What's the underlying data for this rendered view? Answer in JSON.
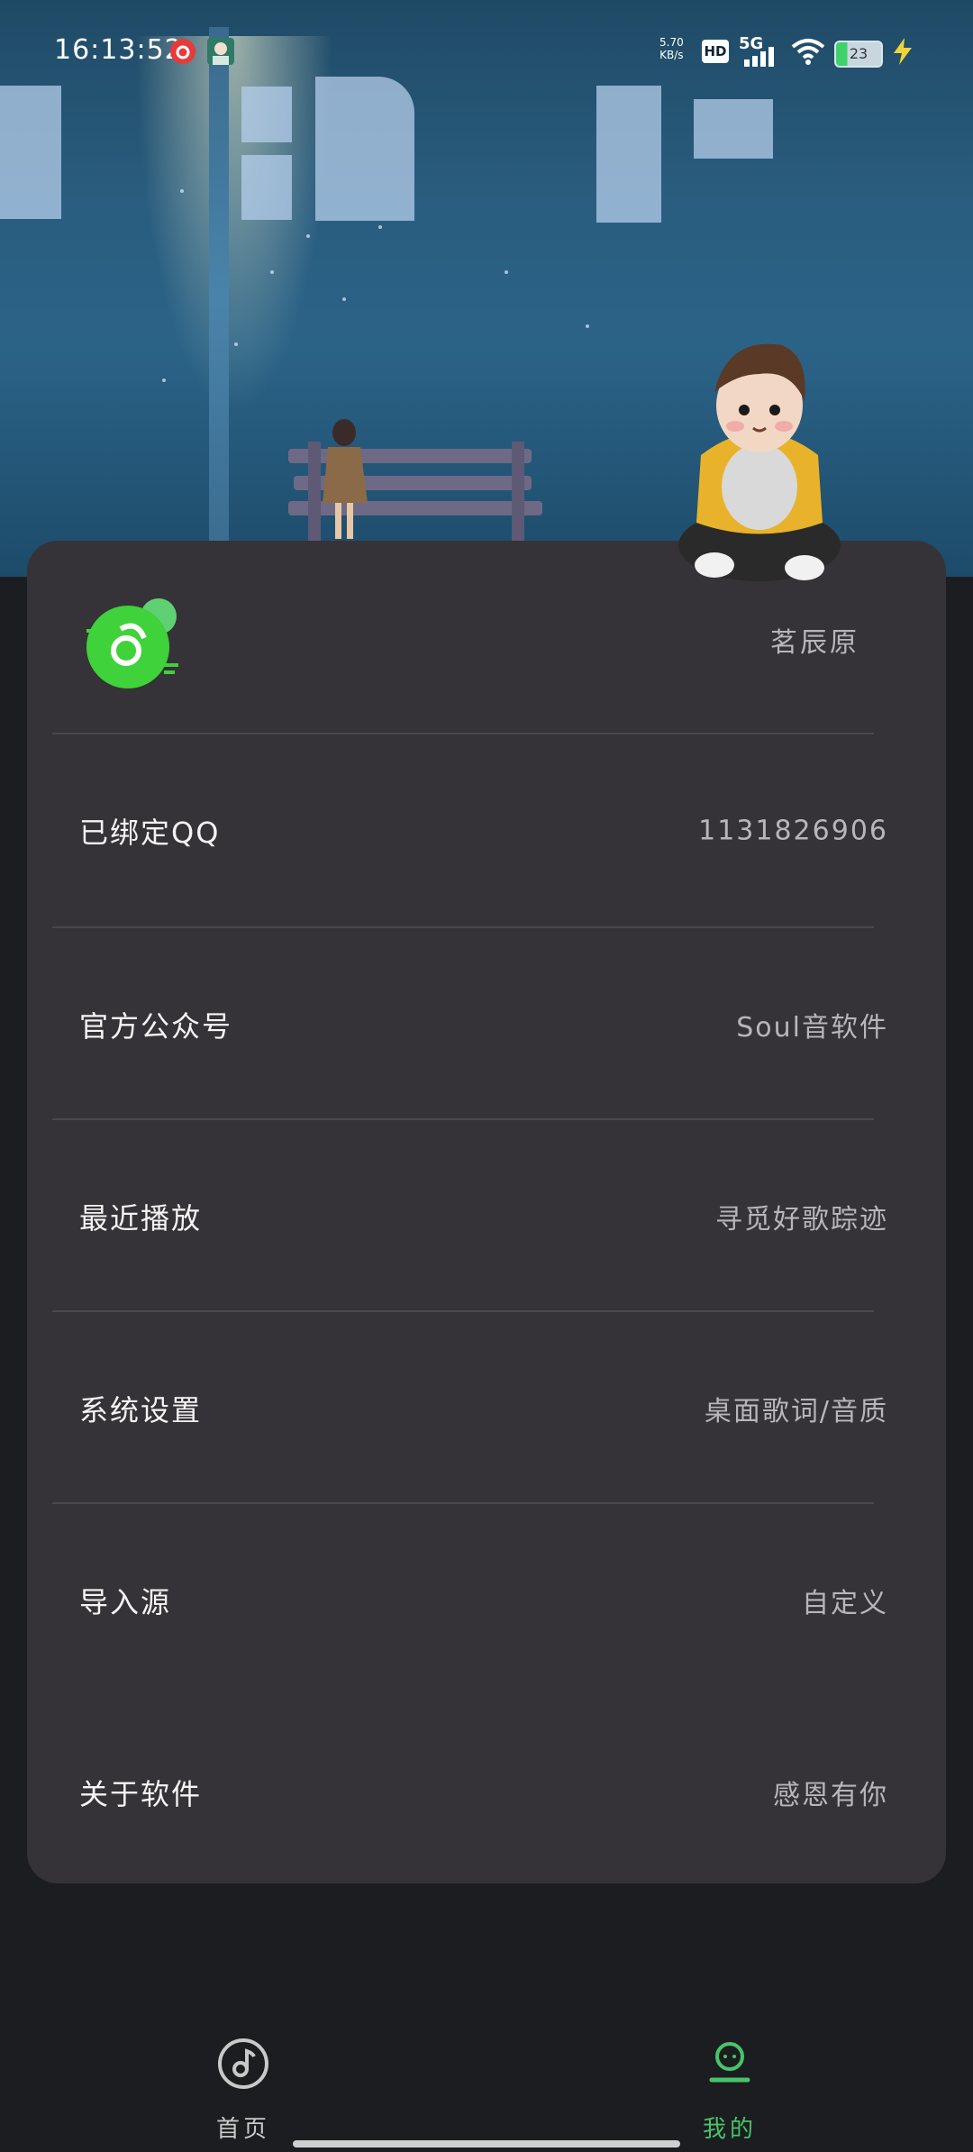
{
  "status_bar": {
    "time": "16:13:52",
    "net_speed_value": "5.70",
    "net_speed_unit": "KB/s",
    "hd_label": "HD",
    "network_type": "5G",
    "battery_level": "23"
  },
  "profile": {
    "username": "茗辰原"
  },
  "menu": {
    "qq_label": "已绑定QQ",
    "qq_value": "1131826906",
    "official_label": "官方公众号",
    "official_value": "Soul音软件",
    "recent_label": "最近播放",
    "recent_value": "寻觅好歌踪迹",
    "settings_label": "系统设置",
    "settings_value": "桌面歌词/音质",
    "import_label": "导入源",
    "import_value": "自定义",
    "about_label": "关于软件",
    "about_value": "感恩有你"
  },
  "bottom_nav": {
    "home_label": "首页",
    "mine_label": "我的",
    "active_color": "#47c46a",
    "inactive_color": "#c9c9c9"
  },
  "colors": {
    "card_bg": "#353337",
    "accent_green": "#3fd23a"
  }
}
